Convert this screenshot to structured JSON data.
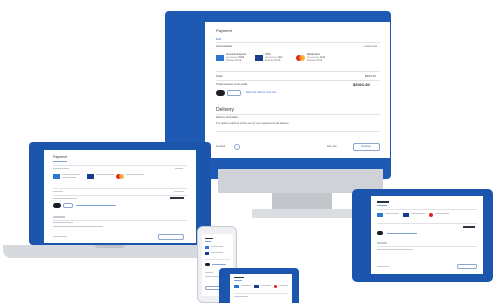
{
  "payment": {
    "title": "Payment",
    "edit_link": "Edit",
    "saved_cards_label": "Card details",
    "new_card_link": "+ Add new",
    "cards": [
      {
        "brand": "amex-icon",
        "name": "American Express",
        "number": "•••• •••• •••• 0005",
        "expiry": "Expires 02/19"
      },
      {
        "brand": "visa-icon",
        "name": "VISA",
        "number": "•••• •••• •••• 1111",
        "expiry": "Expires 03/19"
      },
      {
        "brand": "mastercard-icon",
        "name": "Mastercard",
        "number": "•••• •••• •••• 4444",
        "expiry": "Expires 02/19"
      }
    ],
    "subtotal_label": "Total",
    "subtotal_value": "$363.34",
    "total_label": "Total amount to be paid",
    "total_value": "$2021.30",
    "save_card_label": "Save this card for next time"
  },
  "delivery": {
    "title": "Delivery",
    "address_label": "Delivery information",
    "address_text": "The delivery address will be sent to your registered email address",
    "back_label": "Go back",
    "pay_label": "Pay now",
    "continue_label": "Continue"
  },
  "colors": {
    "device_blue": "#1e5ab4",
    "link_blue": "#2f6fc9",
    "mastercard_red": "#e3231d",
    "mastercard_orange": "#f7a01a"
  }
}
